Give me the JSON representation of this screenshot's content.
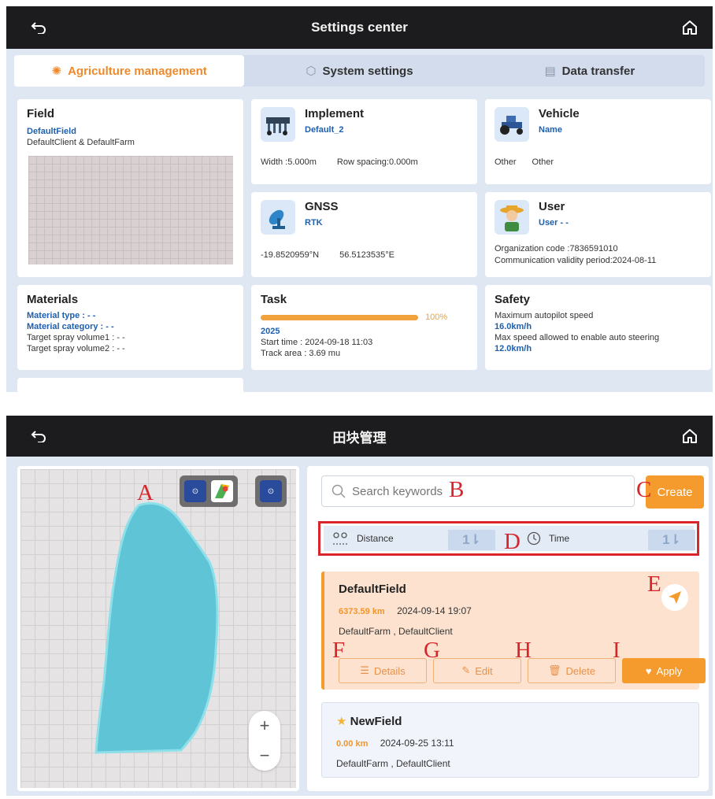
{
  "settings": {
    "title": "Settings center",
    "tabs": [
      {
        "label": "Agriculture management",
        "icon": "gear-sun-icon",
        "active": true
      },
      {
        "label": "System settings",
        "icon": "gear-icon",
        "active": false
      },
      {
        "label": "Data transfer",
        "icon": "database-icon",
        "active": false
      }
    ],
    "field": {
      "heading": "Field",
      "name": "DefaultField",
      "client_farm": "DefaultClient & DefaultFarm"
    },
    "implement": {
      "heading": "Implement",
      "name": "Default_2",
      "width": "Width :5.000m",
      "row_spacing": "Row spacing:0.000m"
    },
    "vehicle": {
      "heading": "Vehicle",
      "name": "Name",
      "type1": "Other",
      "type2": "Other"
    },
    "gnss": {
      "heading": "GNSS",
      "mode": "RTK",
      "lat": "-19.8520959°N",
      "lon": "56.5123535°E"
    },
    "user": {
      "heading": "User",
      "name": "User - -",
      "org": "Organization code :7836591010",
      "validity": "Communication validity period:2024-08-11"
    },
    "materials": {
      "heading": "Materials",
      "type": "Material type : - -",
      "category": "Material category : - -",
      "vol1": "Target spray volume1 : - -",
      "vol2": "Target spray volume2 : - -"
    },
    "task": {
      "heading": "Task",
      "progress": 1.0,
      "progress_label": "100%",
      "name": "2025",
      "start": "Start time : 2024-09-18 11:03",
      "area": "Track area : 3.69 mu"
    },
    "safety": {
      "heading": "Safety",
      "max_label": "Maximum autopilot speed",
      "max_value": "16.0km/h",
      "steer_label": "Max speed allowed to enable auto steering",
      "steer_value": "12.0km/h"
    }
  },
  "field_mgmt": {
    "title": "田块管理",
    "search_placeholder": "Search keywords",
    "create_label": "Create",
    "sort": {
      "distance_label": "Distance",
      "time_label": "Time",
      "distance_arrow": "1⇂",
      "time_arrow": "1⇂"
    },
    "fields": [
      {
        "name": "DefaultField",
        "distance": "6373.59 km",
        "date": "2024-09-14 19:07",
        "owner": "DefaultFarm , DefaultClient",
        "selected": true
      },
      {
        "name": "NewField",
        "distance": "0.00 km",
        "date": "2024-09-25 13:11",
        "owner": "DefaultFarm , DefaultClient",
        "selected": false
      }
    ],
    "actions": {
      "details": "Details",
      "edit": "Edit",
      "delete": "Delete",
      "apply": "Apply"
    },
    "zoom": {
      "in": "+",
      "out": "−"
    },
    "annotations": {
      "A": "A",
      "B": "B",
      "C": "C",
      "D": "D",
      "E": "E",
      "F": "F",
      "G": "G",
      "H": "H",
      "I": "I"
    }
  },
  "colors": {
    "accent": "#f59a2c",
    "link_blue": "#1e5fae",
    "field_fill": "#5ec4d6",
    "highlight_red": "#d9252b"
  }
}
